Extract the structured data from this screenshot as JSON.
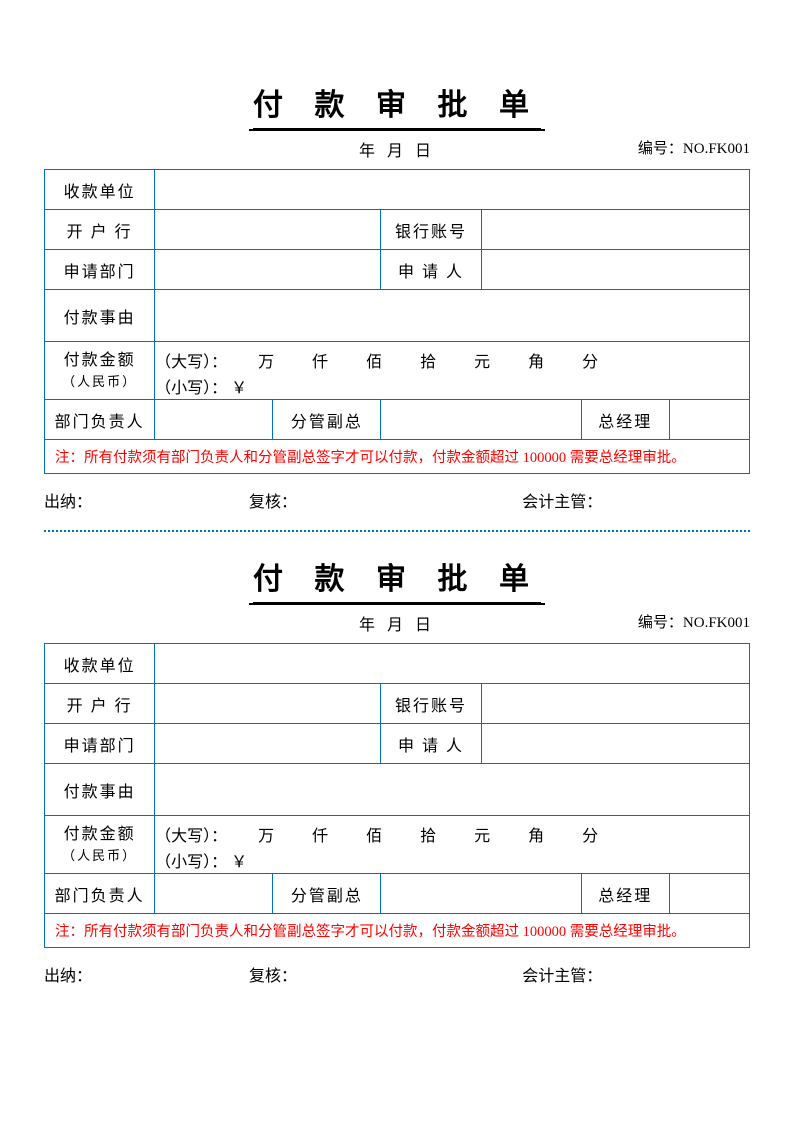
{
  "slip": {
    "title": "付 款 审 批 单",
    "date_line": "年  月  日",
    "serial_label": "编号：",
    "serial_value": "NO.FK001",
    "rows": {
      "payee_label": "收款单位",
      "bank_label": "开 户 行",
      "bank_acct_label": "银行账号",
      "dept_label": "申请部门",
      "applicant_label": "申 请 人",
      "reason_label": "付款事由",
      "amount_label_main": "付款金额",
      "amount_label_sub": "（人民币）",
      "amount_upper_prefix": "（大写）：",
      "amount_units": [
        "万",
        "仟",
        "佰",
        "拾",
        "元",
        "角",
        "分"
      ],
      "amount_lower_prefix": "（小写）： ￥",
      "approver1": "部门负责人",
      "approver2": "分管副总",
      "approver3": "总经理"
    },
    "note": "注：所有付款须有部门负责人和分管副总签字才可以付款，付款金额超过 100000 需要总经理审批。",
    "footer": {
      "cashier": "出纳：",
      "reviewer": "复核：",
      "supervisor": "会计主管："
    }
  }
}
